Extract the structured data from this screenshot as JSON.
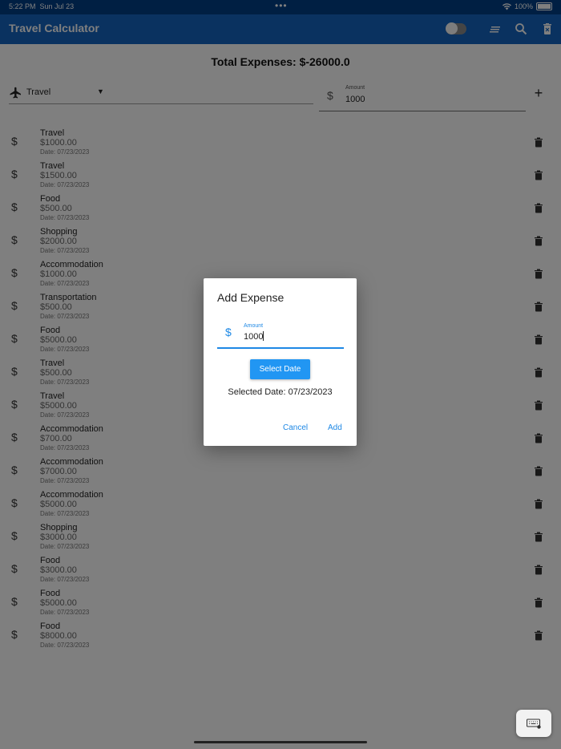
{
  "status_bar": {
    "time": "5:22 PM",
    "date": "Sun Jul 23",
    "battery": "100%"
  },
  "app_bar": {
    "title": "Travel Calculator",
    "icons": [
      "theme-toggle",
      "sort-icon",
      "search-icon",
      "delete-all-icon"
    ]
  },
  "summary": {
    "total_label": "Total Expenses: $-26000.0"
  },
  "input_row": {
    "category": "Travel",
    "amount_label": "Amount",
    "amount_value": "1000"
  },
  "expenses": [
    {
      "category": "Travel",
      "amount": "$1000.00",
      "date": "Date: 07/23/2023"
    },
    {
      "category": "Travel",
      "amount": "$1500.00",
      "date": "Date: 07/23/2023"
    },
    {
      "category": "Food",
      "amount": "$500.00",
      "date": "Date: 07/23/2023"
    },
    {
      "category": "Shopping",
      "amount": "$2000.00",
      "date": "Date: 07/23/2023"
    },
    {
      "category": "Accommodation",
      "amount": "$1000.00",
      "date": "Date: 07/23/2023"
    },
    {
      "category": "Transportation",
      "amount": "$500.00",
      "date": "Date: 07/23/2023"
    },
    {
      "category": "Food",
      "amount": "$5000.00",
      "date": "Date: 07/23/2023"
    },
    {
      "category": "Travel",
      "amount": "$500.00",
      "date": "Date: 07/23/2023"
    },
    {
      "category": "Travel",
      "amount": "$5000.00",
      "date": "Date: 07/23/2023"
    },
    {
      "category": "Accommodation",
      "amount": "$700.00",
      "date": "Date: 07/23/2023"
    },
    {
      "category": "Accommodation",
      "amount": "$7000.00",
      "date": "Date: 07/23/2023"
    },
    {
      "category": "Accommodation",
      "amount": "$5000.00",
      "date": "Date: 07/23/2023"
    },
    {
      "category": "Shopping",
      "amount": "$3000.00",
      "date": "Date: 07/23/2023"
    },
    {
      "category": "Food",
      "amount": "$3000.00",
      "date": "Date: 07/23/2023"
    },
    {
      "category": "Food",
      "amount": "$5000.00",
      "date": "Date: 07/23/2023"
    },
    {
      "category": "Food",
      "amount": "$8000.00",
      "date": "Date: 07/23/2023"
    }
  ],
  "dialog": {
    "title": "Add Expense",
    "amount_label": "Amount",
    "amount_value": "1000",
    "select_date_button": "Select Date",
    "selected_date_text": "Selected Date: 07/23/2023",
    "cancel_button": "Cancel",
    "add_button": "Add"
  },
  "colors": {
    "app_bar": "#1565c0",
    "status_bar": "#003f87",
    "accent": "#2196f3"
  }
}
